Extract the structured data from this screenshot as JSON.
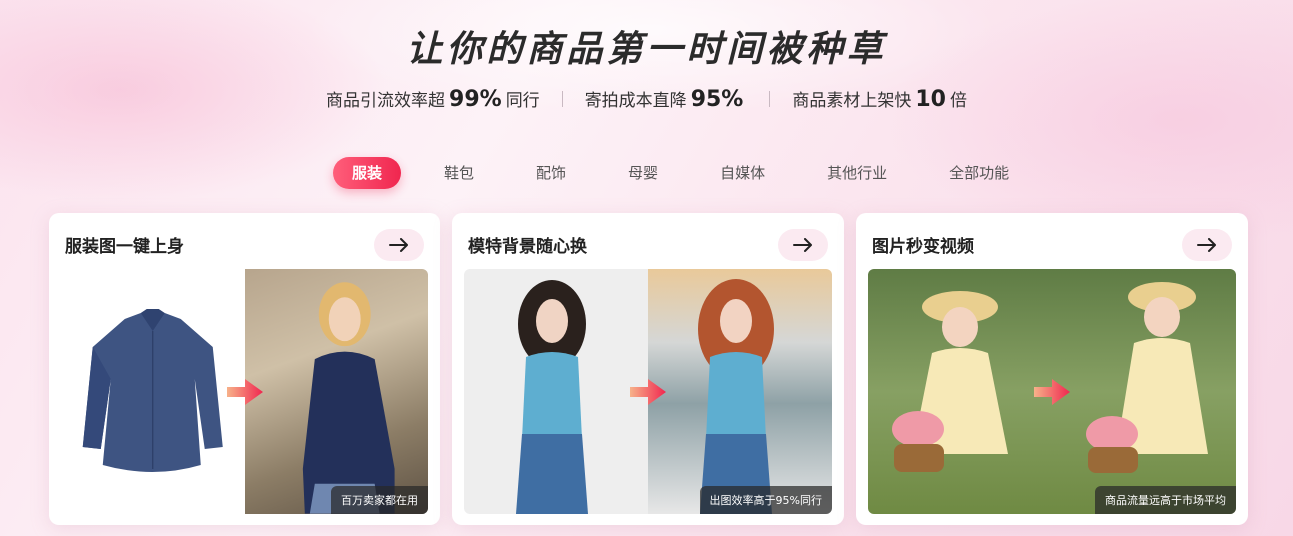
{
  "hero": {
    "title": "让你的商品第一时间被种草",
    "stats": [
      {
        "prefix": "商品引流效率超",
        "value": "99%",
        "suffix": "同行"
      },
      {
        "prefix": "寄拍成本直降",
        "value": "95%",
        "suffix": ""
      },
      {
        "prefix": "商品素材上架快",
        "value": "10",
        "suffix": "倍"
      }
    ]
  },
  "tabs": [
    "服装",
    "鞋包",
    "配饰",
    "母婴",
    "自媒体",
    "其他行业",
    "全部功能"
  ],
  "active_tab": "服装",
  "cards": [
    {
      "title": "服装图一键上身",
      "badge": "百万卖家都在用",
      "arrow_icon": "arrow-right-icon"
    },
    {
      "title": "模特背景随心换",
      "badge": "出图效率高于95%同行",
      "arrow_icon": "arrow-right-icon"
    },
    {
      "title": "图片秒变视频",
      "badge": "商品流量远高于市场平均",
      "arrow_icon": "arrow-right-icon"
    }
  ],
  "colors": {
    "accent": "#f0264f",
    "accent_light": "#ff5e7a",
    "arrow_bg": "#fbeaf1"
  }
}
